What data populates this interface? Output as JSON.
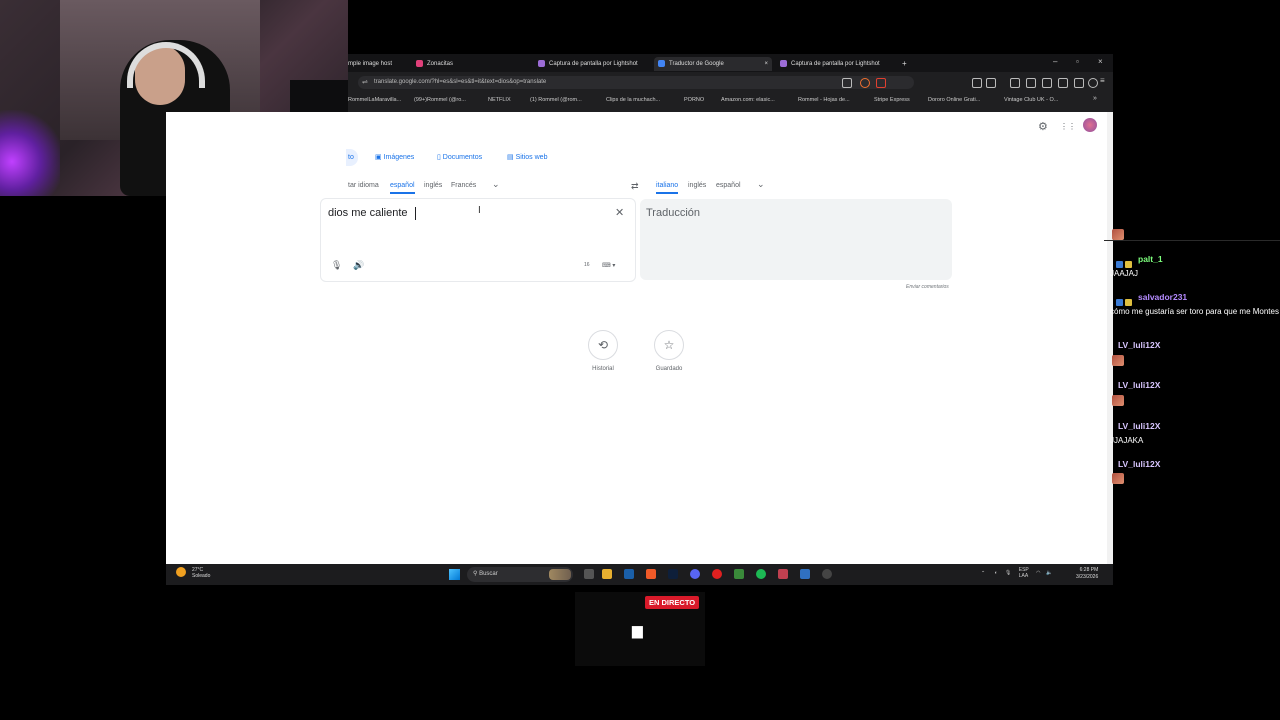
{
  "browser": {
    "tabs": [
      {
        "label": "mple image host",
        "active": false
      },
      {
        "label": "Zonacitas",
        "active": false
      },
      {
        "label": "Captura de pantalla por Lightshot",
        "active": false
      },
      {
        "label": "Traductor de Google",
        "active": true
      },
      {
        "label": "Captura de pantalla por Lightshot",
        "active": false
      }
    ],
    "new_tab": "+",
    "tab_close": "×",
    "win_controls": {
      "minimize": "–",
      "restore": "▫",
      "close": "×"
    },
    "url": "translate.google.com/?hl=es&sl=es&tl=it&text=dios&op=translate",
    "bookmarks": [
      "RommelLaMaravilla...",
      "(99+)Rommel (@ro...",
      "NETFLIX",
      "(1) Rommel (@rom...",
      "Clips de la muchach...",
      "PORNO",
      "Amazon.com: elasic...",
      "Rommel - Hojas de...",
      "Stripe Express",
      "Dororo Online Grati...",
      "Vintage Club UK - O..."
    ],
    "bookmarks_more": "»"
  },
  "translate": {
    "modes": [
      "to",
      "Imágenes",
      "Documentos",
      "Sitios web"
    ],
    "source_langs": [
      "tar idioma",
      "español",
      "inglés",
      "Francés"
    ],
    "target_langs": [
      "italiano",
      "inglés",
      "español"
    ],
    "source_text": "dios me caliente",
    "char_count": "16",
    "target_placeholder": "Traducción",
    "feedback": "Enviar comentarios",
    "history_label": "Historial",
    "saved_label": "Guardado",
    "icons": {
      "settings": "⚙",
      "apps": "⋮⋮",
      "swap": "⇄",
      "clear": "✕",
      "mic": "🎙",
      "speaker": "🔊",
      "history": "⟲",
      "saved": "☆",
      "chevron": "⌄"
    }
  },
  "taskbar": {
    "weather_temp": "27°C",
    "weather_text": "Soleado",
    "search_placeholder": "Buscar",
    "lang_line1": "ESP",
    "lang_line2": "LAA",
    "time": "6:28 PM",
    "date": "3/23/2026"
  },
  "chat": {
    "messages": [
      {
        "user": "palt_1",
        "color": "#7dff7d",
        "text": "JAAJAJ"
      },
      {
        "user": "salvador231",
        "color": "#b58bff",
        "text": "cómo me gustaría ser toro para que me Montes"
      },
      {
        "user": "LV_luli12X",
        "color": "#ffffff",
        "text": ""
      },
      {
        "user": "LV_luli12X",
        "color": "#ffffff",
        "text": ""
      },
      {
        "user": "LV_luli12X",
        "color": "#ffffff",
        "text": "JJAJAKA"
      },
      {
        "user": "LV_luli12X",
        "color": "#ffffff",
        "text": ""
      }
    ]
  },
  "live": {
    "badge": "EN DIRECTO"
  }
}
